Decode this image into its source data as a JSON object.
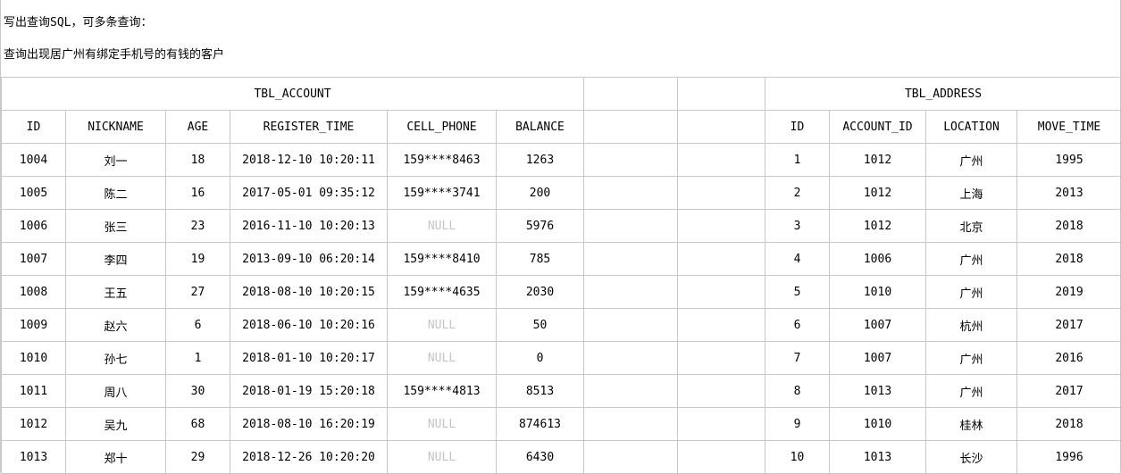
{
  "intro": {
    "line1": "写出查询SQL，可多条查询：",
    "line2": "查询出现居广州有绑定手机号的有钱的客户"
  },
  "account": {
    "title": "TBL_ACCOUNT",
    "columns": [
      "ID",
      "NICKNAME",
      "AGE",
      "REGISTER_TIME",
      "CELL_PHONE",
      "BALANCE"
    ],
    "rows": [
      [
        "1004",
        "刘一",
        "18",
        "2018-12-10 10:20:11",
        "159****8463",
        "1263"
      ],
      [
        "1005",
        "陈二",
        "16",
        "2017-05-01 09:35:12",
        "159****3741",
        "200"
      ],
      [
        "1006",
        "张三",
        "23",
        "2016-11-10 10:20:13",
        "NULL",
        "5976"
      ],
      [
        "1007",
        "李四",
        "19",
        "2013-09-10 06:20:14",
        "159****8410",
        "785"
      ],
      [
        "1008",
        "王五",
        "27",
        "2018-08-10 10:20:15",
        "159****4635",
        "2030"
      ],
      [
        "1009",
        "赵六",
        "6",
        "2018-06-10 10:20:16",
        "NULL",
        "50"
      ],
      [
        "1010",
        "孙七",
        "1",
        "2018-01-10 10:20:17",
        "NULL",
        "0"
      ],
      [
        "1011",
        "周八",
        "30",
        "2018-01-19 15:20:18",
        "159****4813",
        "8513"
      ],
      [
        "1012",
        "吴九",
        "68",
        "2018-08-10 16:20:19",
        "NULL",
        "874613"
      ],
      [
        "1013",
        "郑十",
        "29",
        "2018-12-26 10:20:20",
        "NULL",
        "6430"
      ]
    ]
  },
  "address": {
    "title": "TBL_ADDRESS",
    "columns": [
      "ID",
      "ACCOUNT_ID",
      "LOCATION",
      "MOVE_TIME"
    ],
    "rows": [
      [
        "1",
        "1012",
        "广州",
        "1995"
      ],
      [
        "2",
        "1012",
        "上海",
        "2013"
      ],
      [
        "3",
        "1012",
        "北京",
        "2018"
      ],
      [
        "4",
        "1006",
        "广州",
        "2018"
      ],
      [
        "5",
        "1010",
        "广州",
        "2019"
      ],
      [
        "6",
        "1007",
        "杭州",
        "2017"
      ],
      [
        "7",
        "1007",
        "广州",
        "2016"
      ],
      [
        "8",
        "1013",
        "广州",
        "2017"
      ],
      [
        "9",
        "1010",
        "桂林",
        "2018"
      ],
      [
        "10",
        "1013",
        "长沙",
        "1996"
      ]
    ]
  },
  "colors": {
    "grid": "#c8c8c8",
    "null_text": "#c4c4c4"
  }
}
